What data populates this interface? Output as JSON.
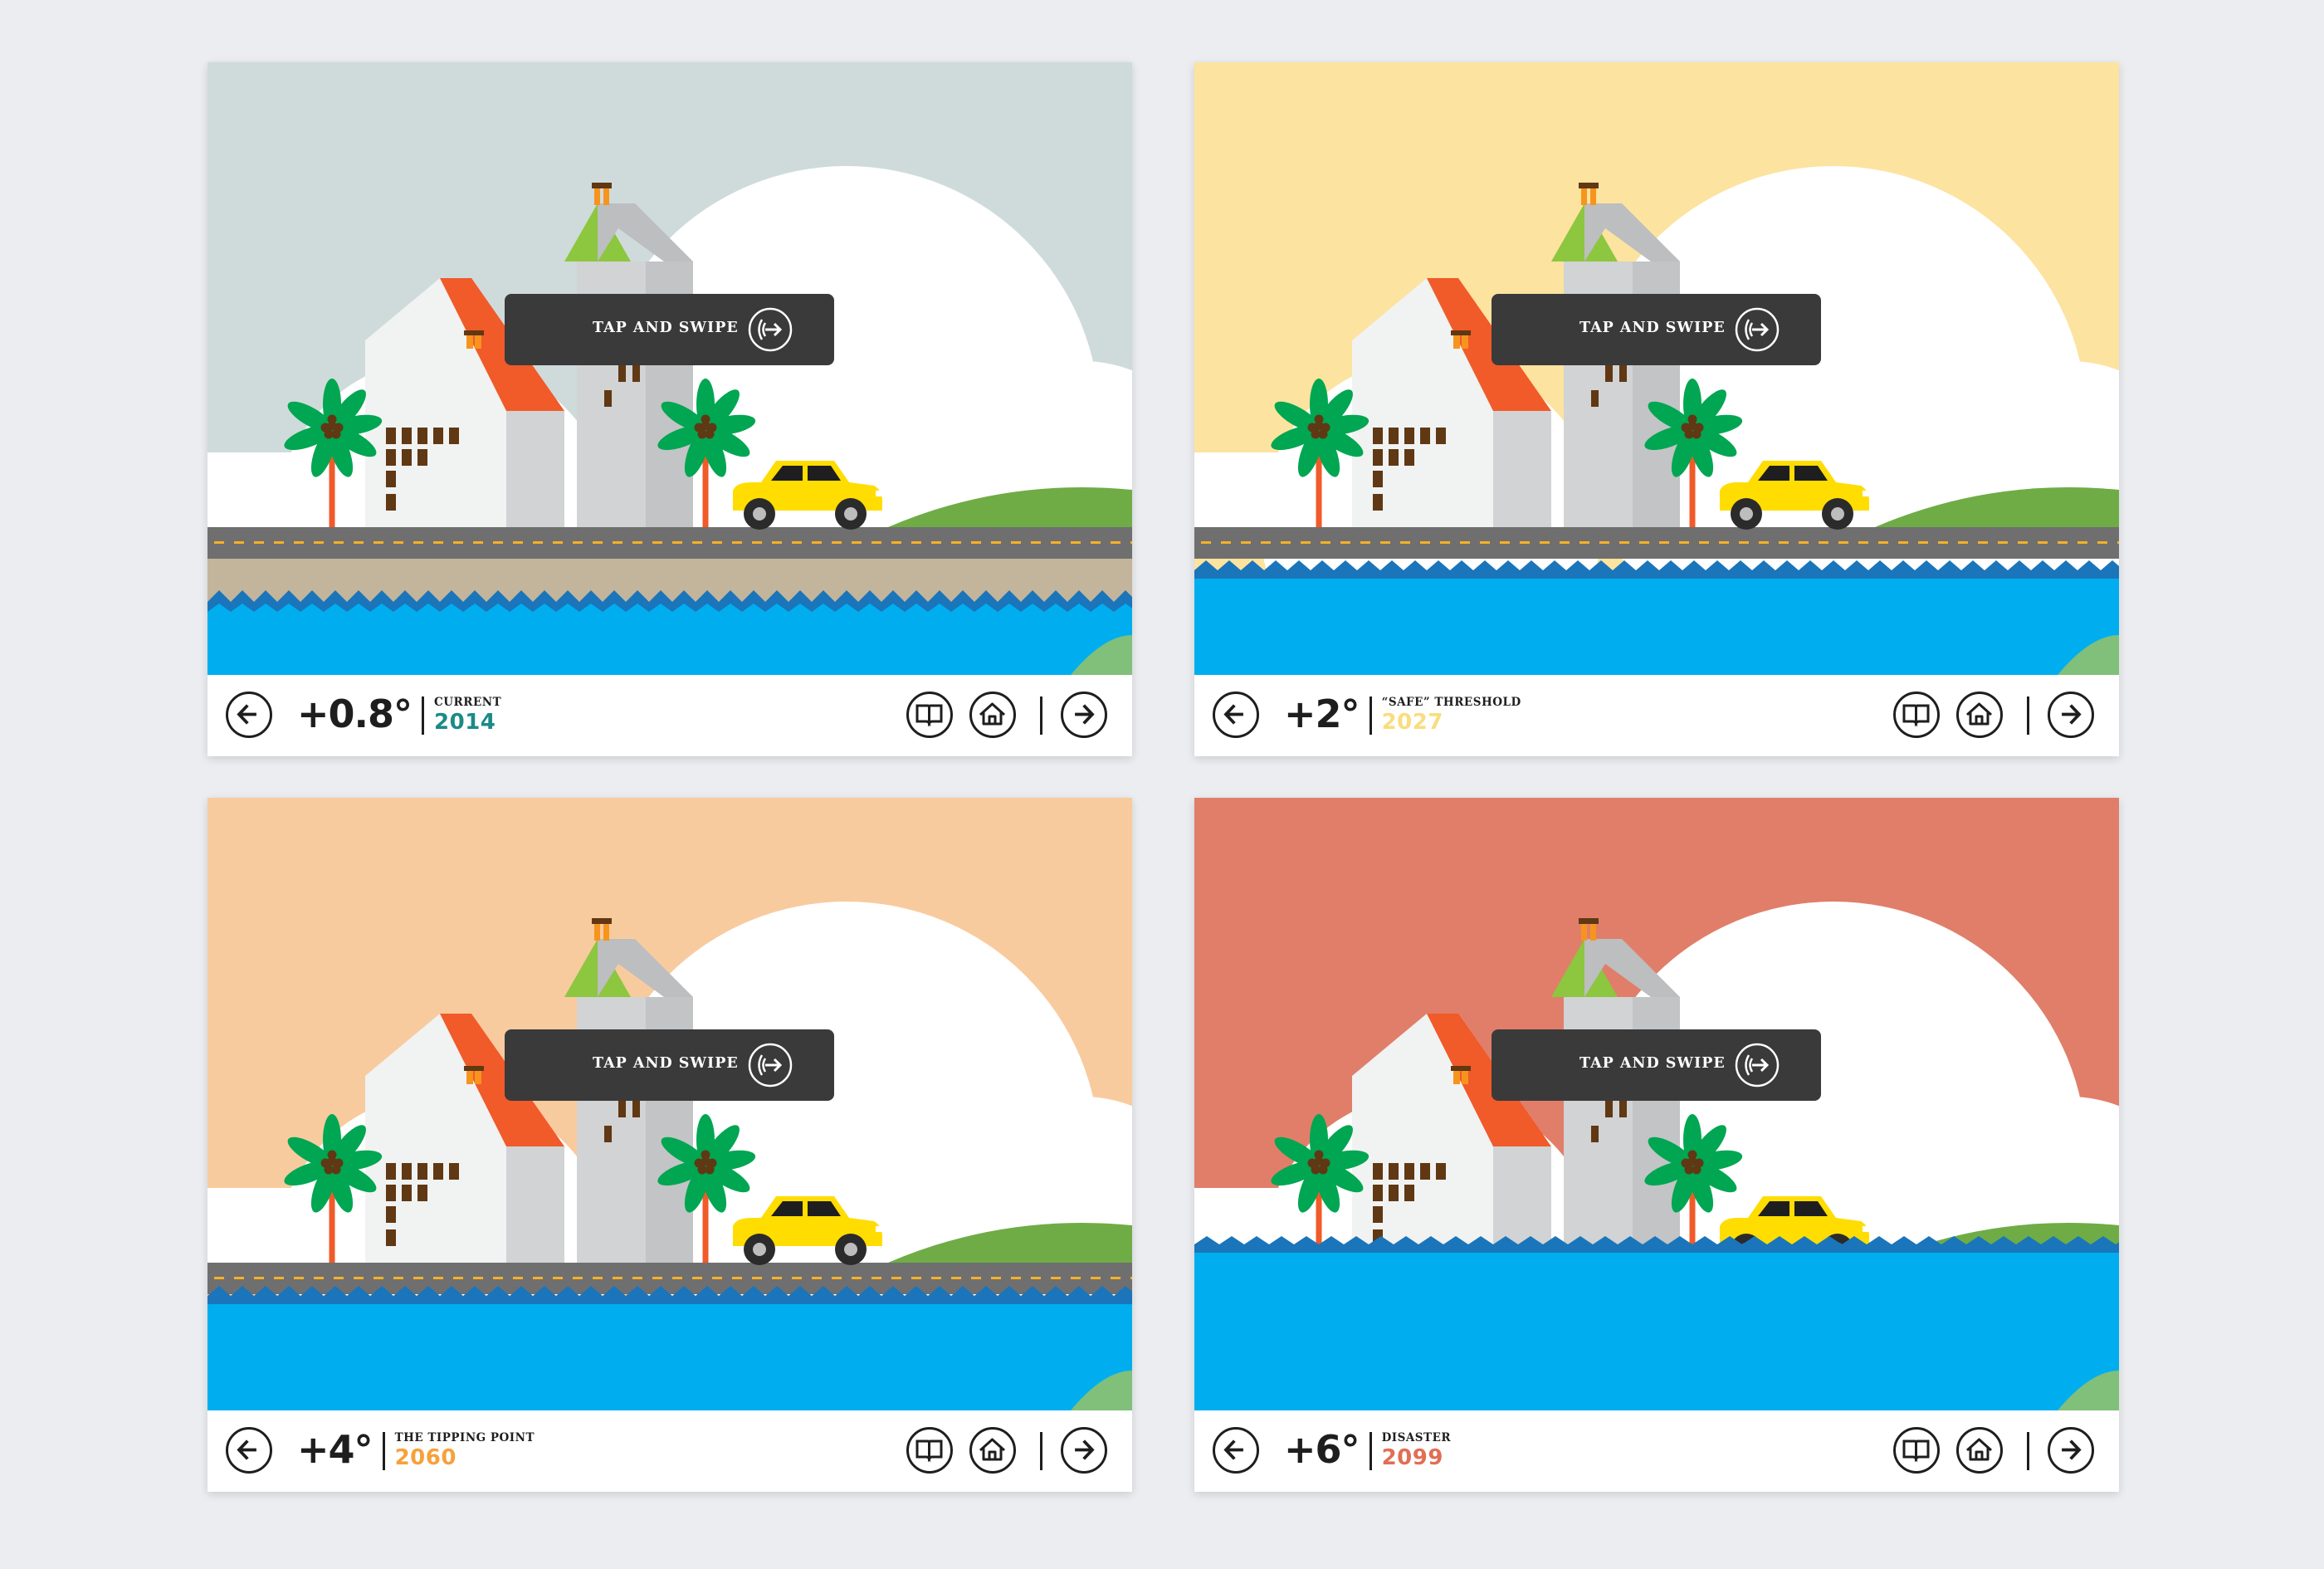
{
  "tooltip": {
    "label": "TAP AND SWIPE",
    "icon": "swipe-gesture-icon"
  },
  "icons": {
    "prev": "arrow-left-icon",
    "book": "book-icon",
    "home": "home-icon",
    "next": "arrow-right-icon"
  },
  "colors": {
    "card_background": "#ffffff",
    "cloud": "#ffffff",
    "road": "#6f6f70",
    "road_dash": "#f6b127",
    "water": "#00aeef",
    "wave": "#1a75bb",
    "car": "#ffdd00",
    "roof": "#f15a29",
    "tower_roof": "#8dc63f",
    "palm_leaf": "#00a651",
    "hill": "#6fac46",
    "text": "#1e1e1e"
  },
  "slides": [
    {
      "temp": "+0.8°",
      "label": "CURRENT",
      "year": "2014",
      "year_color": "#1b8a88",
      "sky_color": "#cfdbdb",
      "stage": "current"
    },
    {
      "temp": "+2°",
      "label": "“SAFE” THRESHOLD",
      "year": "2027",
      "year_color": "#f9dd7f",
      "sky_color": "#fce39f",
      "stage": "threshold"
    },
    {
      "temp": "+4°",
      "label": "THE TIPPING POINT",
      "year": "2060",
      "year_color": "#f6a13b",
      "sky_color": "#f8cb9e",
      "stage": "tipping"
    },
    {
      "temp": "+6°",
      "label": "DISASTER",
      "year": "2099",
      "year_color": "#e06f54",
      "sky_color": "#e07e69",
      "stage": "disaster"
    }
  ]
}
